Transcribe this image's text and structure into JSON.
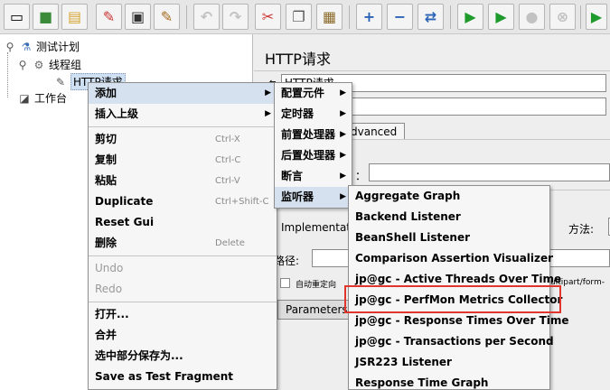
{
  "toolbar": {
    "buttons": [
      "new-icon",
      "templates-icon",
      "open-icon",
      "close-icon",
      "save-icon",
      "save-as-icon",
      "undo-icon",
      "redo-icon",
      "cut-icon",
      "copy-icon",
      "paste-icon",
      "expand-icon",
      "collapse-icon",
      "toggle-icon",
      "start-icon",
      "start-no-pauses-icon",
      "stop-icon",
      "shutdown-icon",
      "remote-start-icon"
    ],
    "glyphs": [
      "▭",
      "■",
      "▤",
      "✎",
      "▣",
      "✎",
      "↶",
      "↷",
      "✂",
      "❐",
      "▦",
      "+",
      "−",
      "⇄",
      "▶",
      "▶",
      "●",
      "⊗",
      "▶"
    ]
  },
  "tree": {
    "test_plan": "测试计划",
    "thread_group": "线程组",
    "http_request": "HTTP请求",
    "workbench": "工作台"
  },
  "right_pane": {
    "title": "HTTP请求",
    "name_prefix": "名",
    "name_value": "HTTP请求",
    "tab_advanced": "Advanced",
    "colon": "：",
    "implementation_label": "Implementation",
    "method_label": "方法:",
    "path_label": "路径:",
    "redirect_checkbox_label": "自动重定向",
    "multipart_label": "ultipart/form-",
    "parameters_label": "Parameters"
  },
  "context_menu": [
    {
      "label": "添加",
      "submenu": true,
      "active": true
    },
    {
      "label": "插入上级",
      "submenu": true
    },
    {
      "sep": true
    },
    {
      "label": "剪切",
      "shortcut": "Ctrl-X"
    },
    {
      "label": "复制",
      "shortcut": "Ctrl-C"
    },
    {
      "label": "粘贴",
      "shortcut": "Ctrl-V"
    },
    {
      "label": "Duplicate",
      "shortcut": "Ctrl+Shift-C"
    },
    {
      "label": "Reset Gui"
    },
    {
      "label": "删除",
      "shortcut": "Delete"
    },
    {
      "sep": true
    },
    {
      "label": "Undo",
      "disabled": true
    },
    {
      "label": "Redo",
      "disabled": true
    },
    {
      "sep": true
    },
    {
      "label": "打开..."
    },
    {
      "label": "合并"
    },
    {
      "label": "选中部分保存为..."
    },
    {
      "label": "Save as Test Fragment"
    }
  ],
  "add_submenu": [
    {
      "label": "配置元件"
    },
    {
      "label": "定时器"
    },
    {
      "label": "前置处理器"
    },
    {
      "label": "后置处理器"
    },
    {
      "label": "断言"
    },
    {
      "label": "监听器",
      "active": true
    }
  ],
  "listener_submenu": [
    "Aggregate Graph",
    "Backend Listener",
    "BeanShell Listener",
    "Comparison Assertion Visualizer",
    "jp@gc - Active Threads Over Time",
    "jp@gc - PerfMon Metrics Collector",
    "jp@gc - Response Times Over Time",
    "jp@gc - Transactions per Second",
    "JSR223 Listener",
    "Response Time Graph"
  ],
  "colors": {
    "highlight_box": "#e0362c",
    "selection": "#cfe0f2"
  }
}
